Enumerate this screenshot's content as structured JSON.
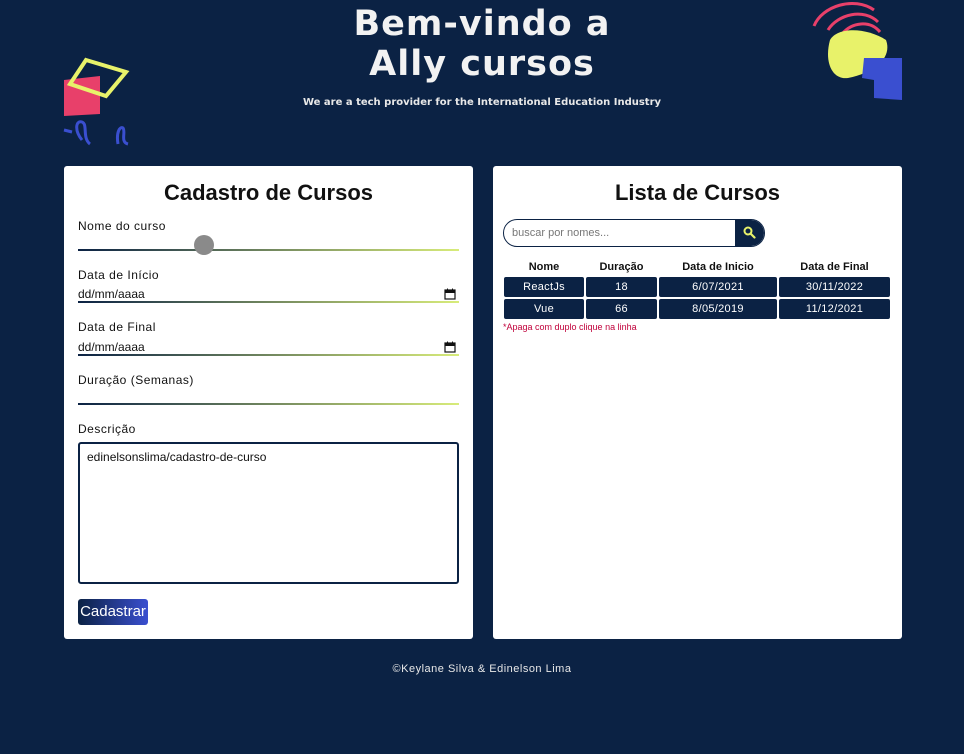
{
  "header": {
    "title_line1": "Bem-vindo a",
    "title_line2": "Ally cursos",
    "tagline": "We are a tech provider for the International Education Industry"
  },
  "form": {
    "title": "Cadastro de Cursos",
    "name_label": "Nome do curso",
    "start_label": "Data de Início",
    "start_value": "dd/mm/aaaa",
    "end_label": "Data de Final",
    "end_value": "dd/mm/aaaa",
    "duration_label": "Duração (Semanas)",
    "description_label": "Descrição",
    "description_value": "edinelsonslima/cadastro-de-curso",
    "submit_label": "Cadastrar"
  },
  "list": {
    "title": "Lista de Cursos",
    "search_placeholder": "buscar por nomes...",
    "columns": [
      "Nome",
      "Duração",
      "Data de Inicio",
      "Data de Final"
    ],
    "rows": [
      [
        "ReactJs",
        "18",
        "6/07/2021",
        "30/11/2022"
      ],
      [
        "Vue",
        "66",
        "8/05/2019",
        "11/12/2021"
      ]
    ],
    "hint": "*Apaga com duplo clique na linha"
  },
  "footer": {
    "text": "©Keylane Silva & Edinelson Lima"
  },
  "colors": {
    "background": "#0b2244",
    "accent_yellow": "#e8f26a",
    "accent_pink": "#e8406a",
    "accent_blue": "#3a4fd0",
    "hint_red": "#c0003a"
  }
}
